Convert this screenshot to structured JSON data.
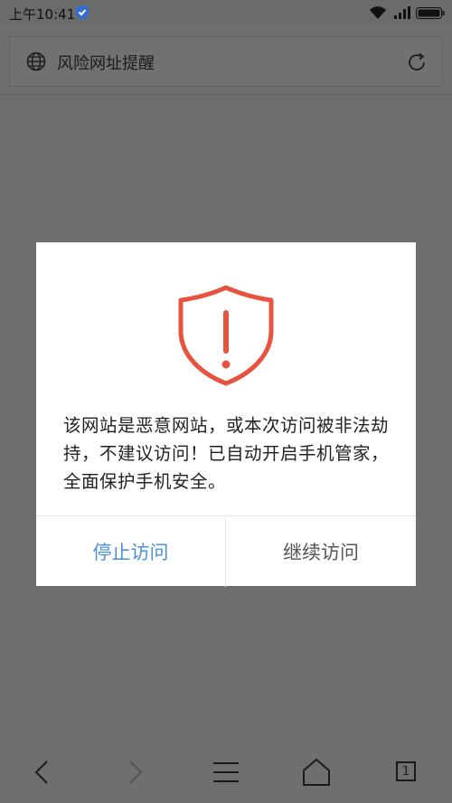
{
  "status_bar": {
    "time": "上午10:41",
    "icons": [
      "shield-badge-icon",
      "wifi-icon",
      "signal-icon",
      "battery-icon"
    ]
  },
  "address_bar": {
    "title": "风险网址提醒",
    "left_icon": "globe-icon",
    "right_icon": "refresh-icon"
  },
  "dialog": {
    "icon": "warning-shield-icon",
    "accent_color": "#e8533d",
    "message": "该网站是恶意网站，或本次访问被非法劫持，不建议访问！已自动开启手机管家，全面保护手机安全。",
    "buttons": {
      "stop": "停止访问",
      "continue": "继续访问"
    },
    "stop_color": "#4a90e2"
  },
  "bottom_nav": {
    "items": [
      "back-icon",
      "forward-icon",
      "menu-icon",
      "home-icon",
      "tabs-icon"
    ],
    "tab_count": "1"
  }
}
